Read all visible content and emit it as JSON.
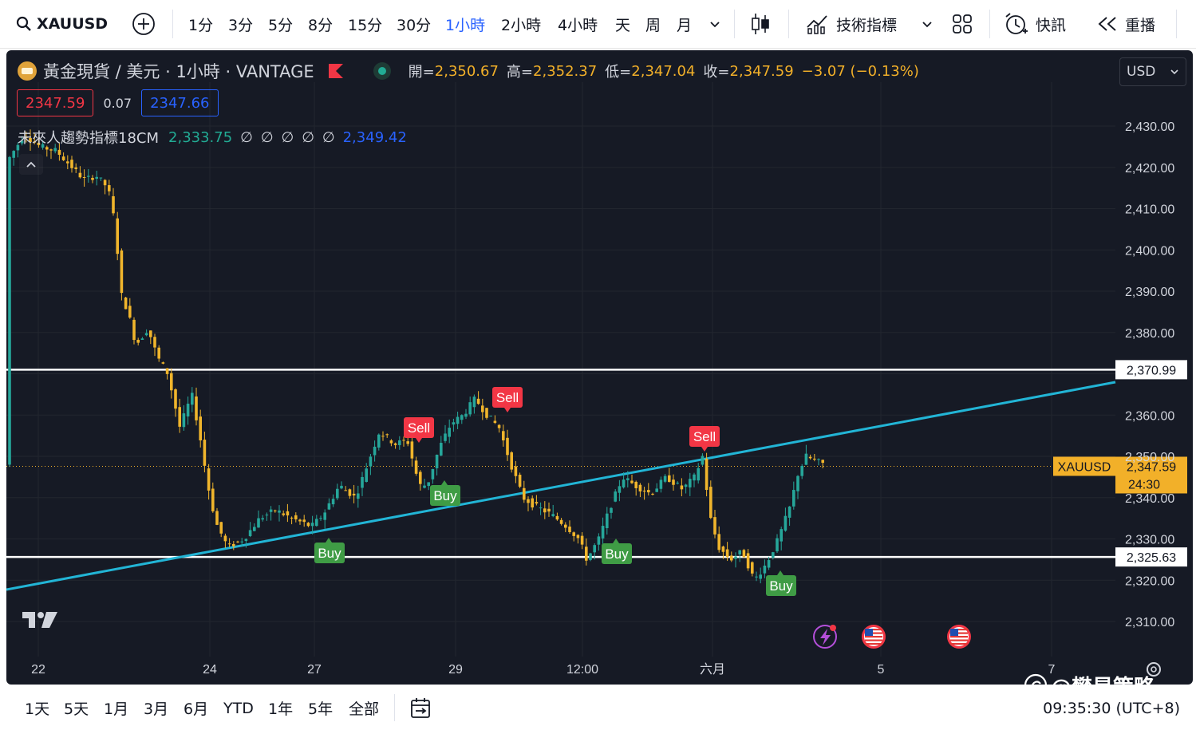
{
  "toolbar": {
    "symbol": "XAUUSD",
    "intervals": [
      "1分",
      "3分",
      "5分",
      "8分",
      "15分",
      "30分",
      "1小時",
      "2小時",
      "4小時",
      "天",
      "周",
      "月"
    ],
    "active_interval": "1小時",
    "indicators_label": "技術指標",
    "alerts_label": "快訊",
    "replay_label": "重播"
  },
  "legend": {
    "title": "黃金現貨 / 美元 · 1小時 · VANTAGE",
    "open_label": "開=",
    "open": "2,350.67",
    "high_label": "高=",
    "high": "2,352.37",
    "low_label": "低=",
    "low": "2,347.04",
    "close_label": "收=",
    "close": "2,347.59",
    "change": "−3.07 (−0.13%)",
    "bid": "2347.59",
    "spread": "0.07",
    "ask": "2347.66"
  },
  "indicator": {
    "name": "未來人趨勢指標18CM",
    "value_green": "2,333.75",
    "empty_values": [
      "∅",
      "∅",
      "∅",
      "∅",
      "∅"
    ],
    "value_blue": "2,349.42"
  },
  "currency": "USD",
  "time_axis": [
    "22",
    "24",
    "27",
    "29",
    "12:00",
    "六月",
    "5",
    "7"
  ],
  "price_axis": [
    "2,430.00",
    "2,420.00",
    "2,410.00",
    "2,400.00",
    "2,390.00",
    "2,380.00",
    "2,360.00",
    "2,350.00",
    "2,340.00",
    "2,330.00",
    "2,320.00",
    "2,310.00"
  ],
  "horizontal_levels": [
    "2,370.99",
    "2,325.63"
  ],
  "last_price": {
    "symbol": "XAUUSD",
    "price": "2,347.59",
    "countdown": "24:30"
  },
  "signals": {
    "buy_label": "Buy",
    "sell_label": "Sell",
    "buy_count": 4,
    "sell_count": 3
  },
  "bottom": {
    "ranges": [
      "1天",
      "5天",
      "1月",
      "3月",
      "6月",
      "YTD",
      "1年",
      "5年",
      "全部"
    ],
    "clock": "09:35:30 (UTC+8)"
  },
  "watermark": "@樊星策略",
  "colors": {
    "up": "#26a69a",
    "down": "#f0b52c",
    "trendline": "#22b5d6",
    "buy": "#3f9c45",
    "sell": "#f23645",
    "background": "#161a25"
  }
}
